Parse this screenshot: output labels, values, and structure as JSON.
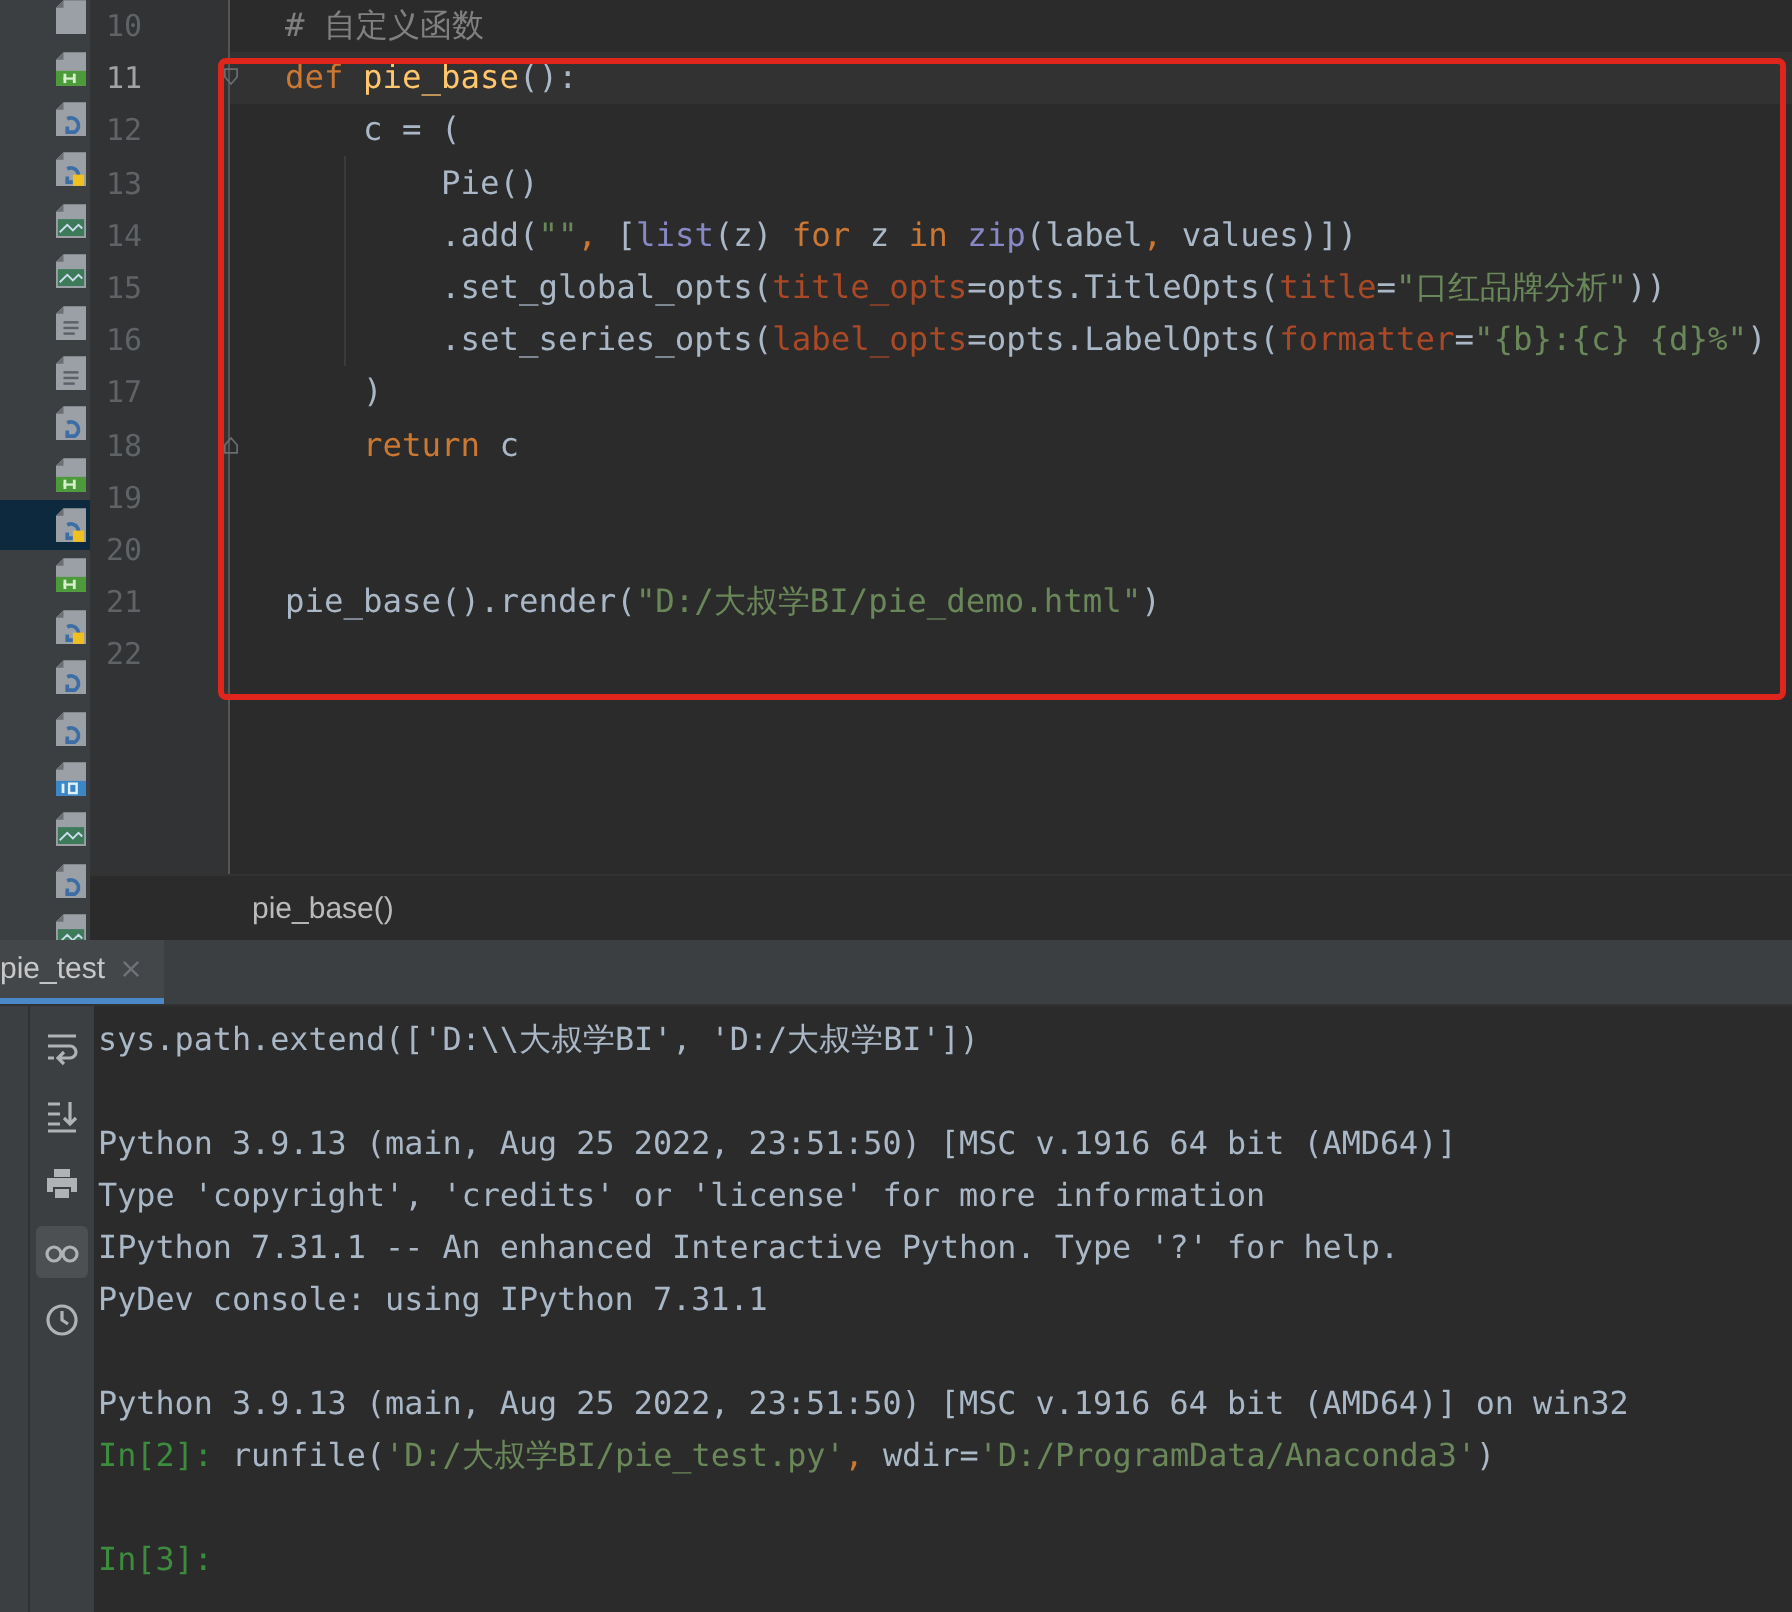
{
  "project_tree": {
    "items": [
      {
        "kind": "file",
        "selected": false
      },
      {
        "kind": "html",
        "selected": false
      },
      {
        "kind": "py",
        "selected": false
      },
      {
        "kind": "pyrun",
        "selected": false
      },
      {
        "kind": "image",
        "selected": false
      },
      {
        "kind": "image",
        "selected": false
      },
      {
        "kind": "text",
        "selected": false
      },
      {
        "kind": "text",
        "selected": false
      },
      {
        "kind": "py",
        "selected": false
      },
      {
        "kind": "html",
        "selected": false
      },
      {
        "kind": "pyrun",
        "selected": true
      },
      {
        "kind": "html",
        "selected": false
      },
      {
        "kind": "pyrun",
        "selected": false
      },
      {
        "kind": "py",
        "selected": false
      },
      {
        "kind": "py",
        "selected": false
      },
      {
        "kind": "ipynb",
        "selected": false
      },
      {
        "kind": "image",
        "selected": false
      },
      {
        "kind": "py",
        "selected": false
      },
      {
        "kind": "image",
        "selected": false
      }
    ]
  },
  "editor": {
    "lines": [
      {
        "number": "10",
        "current": false,
        "fold_start": false,
        "fold_end": false,
        "tokens": [
          {
            "kind": "comment",
            "text": "# 自定义函数"
          }
        ]
      },
      {
        "number": "11",
        "current": true,
        "fold_start": true,
        "fold_end": false,
        "tokens": [
          {
            "kind": "keyword",
            "text": "def"
          },
          {
            "kind": "function",
            "text": " pie_base"
          },
          {
            "kind": "plain",
            "text": "():"
          }
        ]
      },
      {
        "number": "12",
        "current": false,
        "fold_start": false,
        "fold_end": false,
        "tokens": [
          {
            "kind": "plain",
            "text": "    c = ("
          }
        ]
      },
      {
        "number": "13",
        "current": false,
        "fold_start": false,
        "fold_end": false,
        "tokens": [
          {
            "kind": "plain",
            "text": "        Pie()"
          }
        ]
      },
      {
        "number": "14",
        "current": false,
        "fold_start": false,
        "fold_end": false,
        "tokens": [
          {
            "kind": "plain",
            "text": "        .add("
          },
          {
            "kind": "string",
            "text": "\"\""
          },
          {
            "kind": "keyword",
            "text": ", "
          },
          {
            "kind": "plain",
            "text": "["
          },
          {
            "kind": "builtin",
            "text": "list"
          },
          {
            "kind": "plain",
            "text": "(z) "
          },
          {
            "kind": "keyword",
            "text": "for"
          },
          {
            "kind": "plain",
            "text": " z "
          },
          {
            "kind": "keyword",
            "text": "in"
          },
          {
            "kind": "builtin",
            "text": " zip"
          },
          {
            "kind": "plain",
            "text": "(label"
          },
          {
            "kind": "keyword",
            "text": ", "
          },
          {
            "kind": "plain",
            "text": "values)])"
          }
        ]
      },
      {
        "number": "15",
        "current": false,
        "fold_start": false,
        "fold_end": false,
        "tokens": [
          {
            "kind": "plain",
            "text": "        .set_global_opts("
          },
          {
            "kind": "param",
            "text": "title_opts"
          },
          {
            "kind": "plain",
            "text": "=opts.TitleOpts("
          },
          {
            "kind": "param",
            "text": "title"
          },
          {
            "kind": "plain",
            "text": "="
          },
          {
            "kind": "string",
            "text": "\"口红品牌分析\""
          },
          {
            "kind": "plain",
            "text": "))"
          }
        ]
      },
      {
        "number": "16",
        "current": false,
        "fold_start": false,
        "fold_end": false,
        "tokens": [
          {
            "kind": "plain",
            "text": "        .set_series_opts("
          },
          {
            "kind": "param",
            "text": "label_opts"
          },
          {
            "kind": "plain",
            "text": "=opts.LabelOpts("
          },
          {
            "kind": "param",
            "text": "formatter"
          },
          {
            "kind": "plain",
            "text": "="
          },
          {
            "kind": "string",
            "text": "\"{b}:{c} {d}%\""
          },
          {
            "kind": "plain",
            "text": ")"
          }
        ]
      },
      {
        "number": "17",
        "current": false,
        "fold_start": false,
        "fold_end": false,
        "tokens": [
          {
            "kind": "plain",
            "text": "    )"
          }
        ]
      },
      {
        "number": "18",
        "current": false,
        "fold_start": false,
        "fold_end": true,
        "tokens": [
          {
            "kind": "keyword",
            "text": "    return"
          },
          {
            "kind": "plain",
            "text": " c"
          }
        ]
      },
      {
        "number": "19",
        "current": false,
        "fold_start": false,
        "fold_end": false
      },
      {
        "number": "20",
        "current": false,
        "fold_start": false,
        "fold_end": false
      },
      {
        "number": "21",
        "current": false,
        "fold_start": false,
        "fold_end": false,
        "tokens": [
          {
            "kind": "plain",
            "text": "pie_base().render("
          },
          {
            "kind": "string",
            "text": "\"D:/大叔学BI/pie_demo.html\""
          },
          {
            "kind": "plain",
            "text": ")"
          }
        ]
      },
      {
        "number": "22",
        "current": false,
        "fold_start": false,
        "fold_end": false
      }
    ]
  },
  "breadcrumb": "pie_base()",
  "console_tab": {
    "label": "pie_test",
    "selected": true
  },
  "console": {
    "toolbar": [
      {
        "kind": "wrap",
        "selected": false
      },
      {
        "kind": "scroll-end",
        "selected": false
      },
      {
        "kind": "print",
        "selected": false
      },
      {
        "kind": "glasses",
        "selected": true
      },
      {
        "kind": "history",
        "selected": false
      }
    ],
    "blocks": [
      [
        {
          "tokens": [
            {
              "kind": "plain",
              "text": "sys.path.extend(['D:\\\\大叔学BI', 'D:/大叔学BI'])"
            }
          ]
        }
      ],
      [
        {
          "tokens": [
            {
              "kind": "plain",
              "text": "Python 3.9.13 (main, Aug 25 2022, 23:51:50) [MSC v.1916 64 bit (AMD64)]"
            }
          ]
        },
        {
          "tokens": [
            {
              "kind": "plain",
              "text": "Type 'copyright', 'credits' or 'license' for more information"
            }
          ]
        },
        {
          "tokens": [
            {
              "kind": "plain",
              "text": "IPython 7.31.1 -- An enhanced Interactive Python. Type '?' for help."
            }
          ]
        },
        {
          "tokens": [
            {
              "kind": "plain",
              "text": "PyDev console: using IPython 7.31.1"
            }
          ]
        }
      ],
      [
        {
          "tokens": [
            {
              "kind": "plain",
              "text": "Python 3.9.13 (main, Aug 25 2022, 23:51:50) [MSC v.1916 64 bit (AMD64)] on win32"
            }
          ]
        },
        {
          "tokens": [
            {
              "kind": "prompt",
              "text": "In[2]:"
            },
            {
              "kind": "plain",
              "text": " runfile("
            },
            {
              "kind": "string",
              "text": "'D:/大叔学BI/pie_test.py'"
            },
            {
              "kind": "keyword",
              "text": ", "
            },
            {
              "kind": "plain",
              "text": "wdir="
            },
            {
              "kind": "string",
              "text": "'D:/ProgramData/Anaconda3'"
            },
            {
              "kind": "plain",
              "text": ")"
            }
          ]
        }
      ],
      [
        {
          "tokens": [
            {
              "kind": "prompt",
              "text": "In[3]:"
            }
          ]
        }
      ]
    ]
  }
}
